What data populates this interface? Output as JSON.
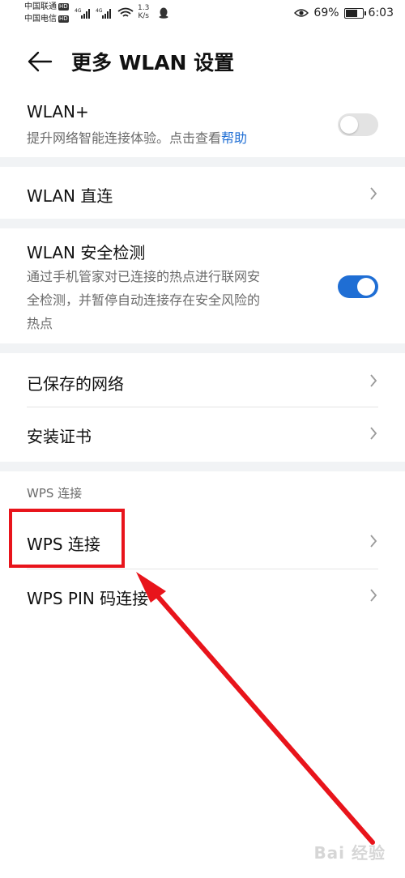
{
  "status_bar": {
    "carrier1": "中国联通",
    "carrier2": "中国电信",
    "hd": "HD",
    "speed_value": "1.3",
    "speed_unit": "K/s",
    "battery": "69%",
    "time": "6:03"
  },
  "header": {
    "title": "更多 WLAN 设置"
  },
  "wlan_plus": {
    "title": "WLAN+",
    "subtitle": "提升网络智能连接体验。点击查看",
    "help_link": "帮助",
    "toggle_on": false
  },
  "wlan_direct": {
    "title": "WLAN 直连"
  },
  "wlan_security": {
    "title": "WLAN 安全检测",
    "subtitle_lines": [
      "通过手机管家对已连接的热点进行联网安",
      "全检测，并暂停自动连接存在安全风险的",
      "热点"
    ],
    "toggle_on": true
  },
  "saved_networks": {
    "title": "已保存的网络"
  },
  "install_cert": {
    "title": "安装证书"
  },
  "wps_section": {
    "header": "WPS 连接",
    "wps_connect": "WPS 连接",
    "wps_pin": "WPS PIN 码连接"
  },
  "watermark": "Bai 经验",
  "colors": {
    "accent": "#1f6ed4",
    "annotation_red": "#e8141b"
  }
}
